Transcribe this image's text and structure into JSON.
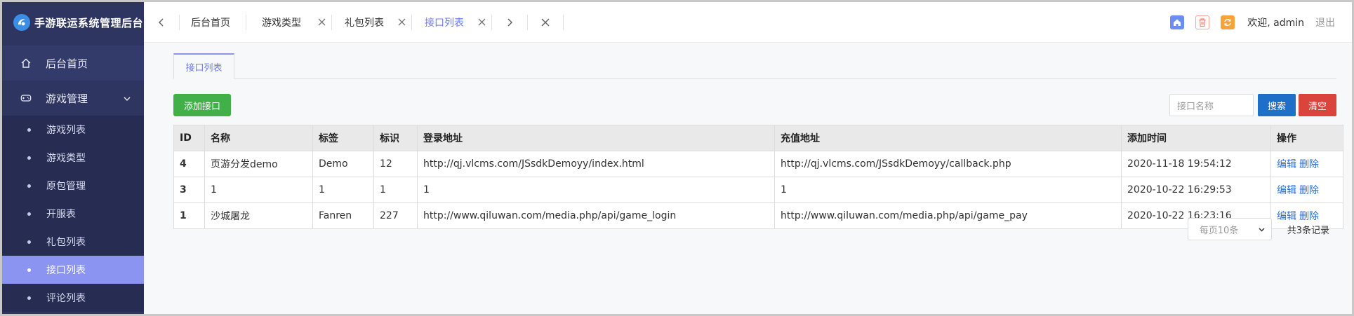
{
  "app": {
    "title": "手游联运系统管理后台"
  },
  "sidebar": {
    "home_label": "后台首页",
    "group_label": "游戏管理",
    "items": [
      {
        "label": "游戏列表"
      },
      {
        "label": "游戏类型"
      },
      {
        "label": "原包管理"
      },
      {
        "label": "开服表"
      },
      {
        "label": "礼包列表"
      },
      {
        "label": "接口列表"
      },
      {
        "label": "评论列表"
      }
    ],
    "active_item": "接口列表"
  },
  "topbar": {
    "tabs": [
      {
        "label": "后台首页",
        "closable": false
      },
      {
        "label": "游戏类型",
        "closable": true
      },
      {
        "label": "礼包列表",
        "closable": true
      },
      {
        "label": "接口列表",
        "closable": true
      }
    ],
    "active_tab": "接口列表",
    "welcome": "欢迎, admin",
    "logout": "退出",
    "icons": [
      "home-icon",
      "trash-icon",
      "refresh-icon"
    ],
    "colors": {
      "home": "#6b8ef2",
      "trash": "#f2a59a",
      "refresh": "#f7a23b"
    }
  },
  "page": {
    "tab_label": "接口列表",
    "add_button": "添加接口",
    "search_placeholder": "接口名称",
    "search_button": "搜索",
    "clear_button": "清空"
  },
  "table": {
    "columns": [
      "ID",
      "名称",
      "标签",
      "标识",
      "登录地址",
      "充值地址",
      "添加时间",
      "操作"
    ],
    "rows": [
      {
        "id": "4",
        "name": "页游分发demo",
        "tag": "Demo",
        "flag": "12",
        "login_url": "http://qj.vlcms.com/JSsdkDemoyy/index.html",
        "pay_url": "http://qj.vlcms.com/JSsdkDemoyy/callback.php",
        "time": "2020-11-18 19:54:12",
        "edit": "编辑",
        "delete": "删除"
      },
      {
        "id": "3",
        "name": "1",
        "tag": "1",
        "flag": "1",
        "login_url": "1",
        "pay_url": "1",
        "time": "2020-10-22 16:29:53",
        "edit": "编辑",
        "delete": "删除"
      },
      {
        "id": "1",
        "name": "沙城屠龙",
        "tag": "Fanren",
        "flag": "227",
        "login_url": "http://www.qiluwan.com/media.php/api/game_login",
        "pay_url": "http://www.qiluwan.com/media.php/api/game_pay",
        "time": "2020-10-22 16:23:16",
        "edit": "编辑",
        "delete": "删除"
      }
    ]
  },
  "pager": {
    "per_page": "每页10条",
    "total": "共3条记录"
  }
}
